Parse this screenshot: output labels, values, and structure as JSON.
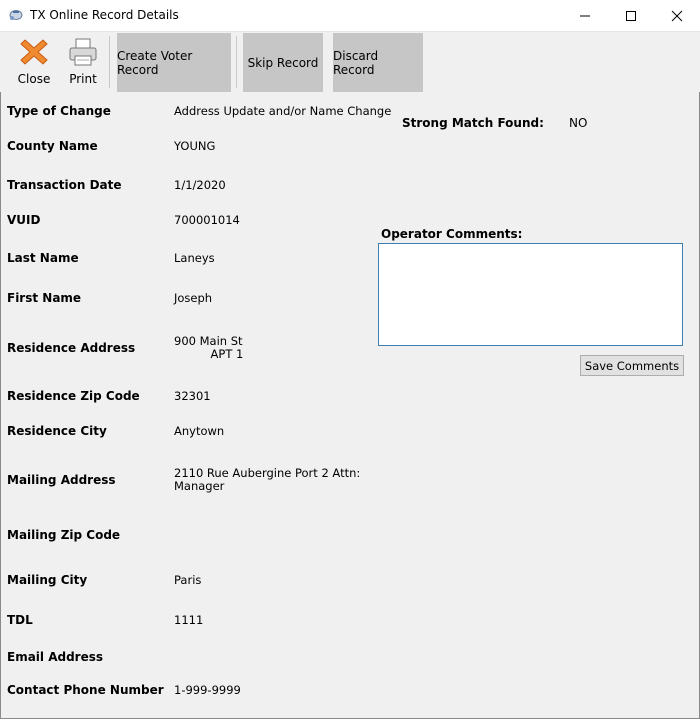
{
  "window": {
    "title": "TX Online Record Details"
  },
  "toolbar": {
    "close_label": "Close",
    "print_label": "Print",
    "create_label": "Create Voter Record",
    "skip_label": "Skip Record",
    "discard_label": "Discard Record"
  },
  "fields": [
    {
      "label": "Type of Change",
      "value": "Address Update and/or Name Change"
    },
    {
      "label": "County Name",
      "value": "YOUNG"
    },
    {
      "label": "Transaction Date",
      "value": "1/1/2020"
    },
    {
      "label": "VUID",
      "value": "700001014"
    },
    {
      "label": "Last Name",
      "value": "Laneys"
    },
    {
      "label": "First Name",
      "value": "Joseph"
    },
    {
      "label": "Residence Address",
      "value": "900 Main St\n          APT 1"
    },
    {
      "label": "Residence Zip Code",
      "value": "32301"
    },
    {
      "label": "Residence City",
      "value": "Anytown"
    },
    {
      "label": "Mailing Address",
      "value": "2110 Rue Aubergine Port 2 Attn:\nManager"
    },
    {
      "label": "Mailing Zip Code",
      "value": ""
    },
    {
      "label": "Mailing City",
      "value": "Paris"
    },
    {
      "label": "TDL",
      "value": "1111"
    },
    {
      "label": "Email Address",
      "value": ""
    },
    {
      "label": "Contact Phone Number",
      "value": "1-999-9999"
    }
  ],
  "match": {
    "label": "Strong Match Found:",
    "value": "NO"
  },
  "comments": {
    "label": "Operator Comments:",
    "value": "",
    "save_label": "Save Comments"
  }
}
